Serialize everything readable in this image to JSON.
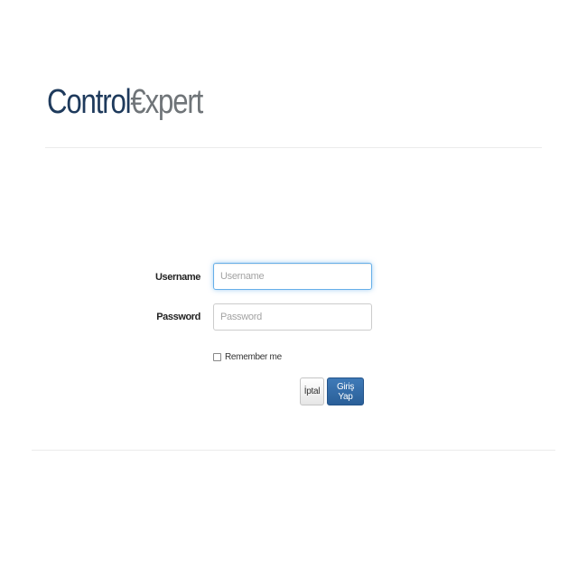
{
  "brand": {
    "logo_part1": "Control",
    "logo_part2": "€xpert",
    "color_primary": "#1e3a5c",
    "color_secondary": "#6f7478"
  },
  "login_form": {
    "username_label": "Username",
    "username_placeholder": "Username",
    "username_value": "",
    "password_label": "Password",
    "password_placeholder": "Password",
    "password_value": "",
    "remember_label": "Remember me",
    "remember_checked": false,
    "cancel_label": "İptal",
    "submit_label": "Giriş Yap",
    "submit_color": "#2f6aa8"
  }
}
